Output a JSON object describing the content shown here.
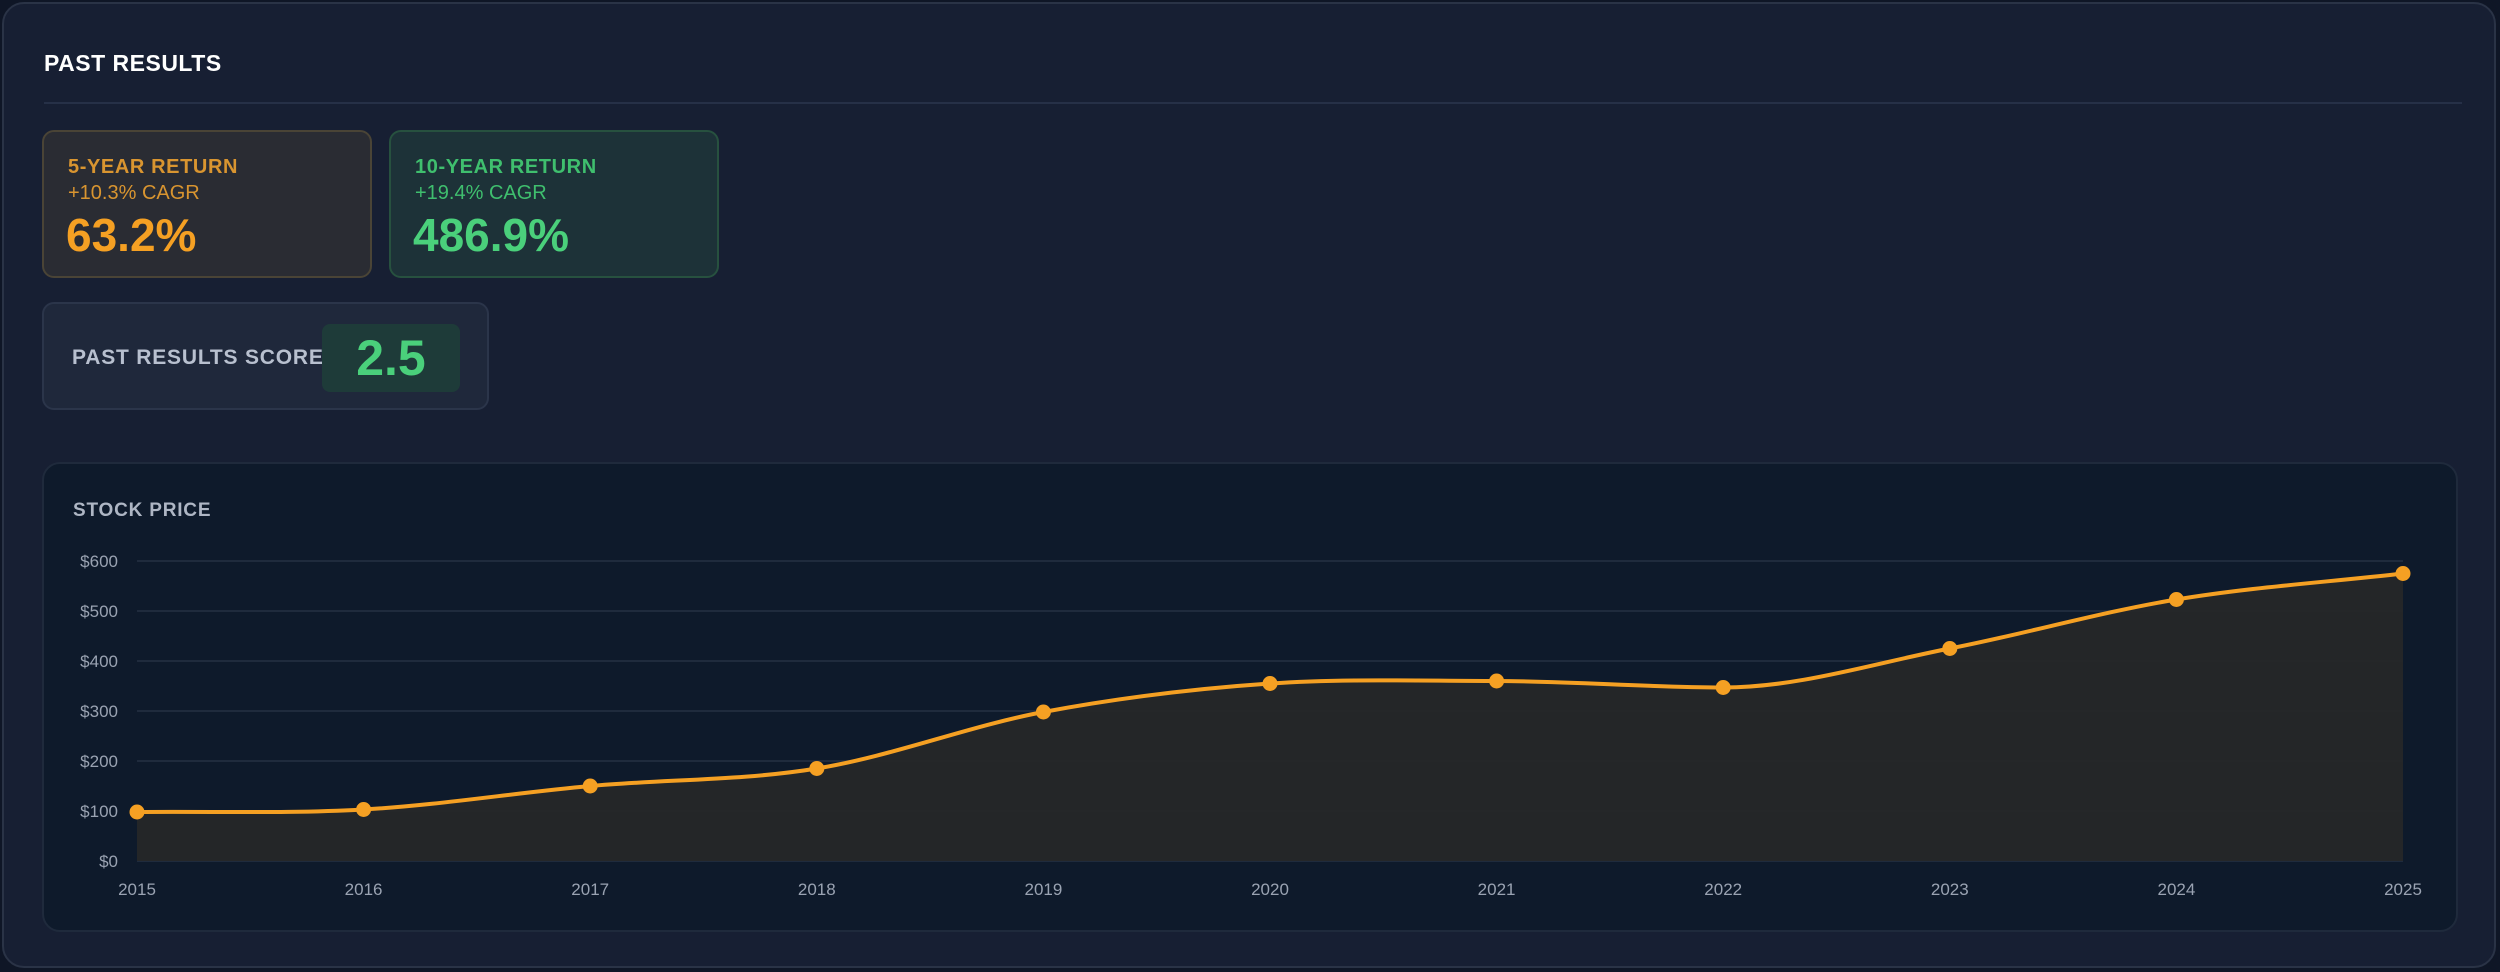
{
  "section": {
    "title": "PAST RESULTS"
  },
  "cards": [
    {
      "label": "5-YEAR RETURN",
      "subtitle": "+10.3% CAGR",
      "value": "63.2%",
      "color": "#f5a023"
    },
    {
      "label": "10-YEAR RETURN",
      "subtitle": "+19.4% CAGR",
      "value": "486.9%",
      "color": "#4ad07b"
    }
  ],
  "score": {
    "label": "PAST RESULTS SCORE",
    "value": "2.5"
  },
  "colors": {
    "accent_orange": "#f5a023",
    "accent_green": "#4ad07b"
  },
  "chart_data": {
    "type": "area",
    "title": "STOCK PRICE",
    "x": [
      "2015",
      "2016",
      "2017",
      "2018",
      "2019",
      "2020",
      "2021",
      "2022",
      "2023",
      "2024",
      "2025"
    ],
    "values": [
      98,
      103,
      150,
      185,
      298,
      355,
      360,
      347,
      425,
      523,
      575
    ],
    "ylim": [
      0,
      600
    ],
    "yticks": [
      0,
      100,
      200,
      300,
      400,
      500,
      600
    ],
    "ytick_labels": [
      "$0",
      "$100",
      "$200",
      "$300",
      "$400",
      "$500",
      "$600"
    ],
    "grid": true,
    "line_color": "#f5a023"
  }
}
